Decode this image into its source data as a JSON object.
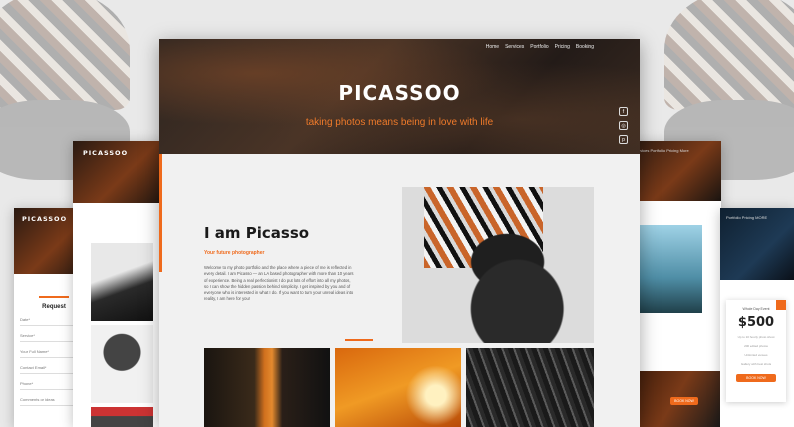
{
  "main": {
    "nav": [
      "Home",
      "Services",
      "Portfolio",
      "Pricing",
      "Booking"
    ],
    "hero_title": "PICASSOO",
    "hero_tagline": "taking photos means being in love with life",
    "social": [
      "f",
      "◎",
      "p"
    ],
    "about_title": "I am Picasso",
    "about_subtitle": "Your future photographer",
    "about_body": "Welcome to my photo portfolio and the place where a piece of me is reflected in every detail. I am Picasso — an LA based photographer with more than 10 years of experience. Being a real perfectionist I do put lots of effort into all my photos, so I can show the hidden passion behind simplicity. I get inspired by you and of everyone who is interested in what I do. If you want to turn your unreal ideas into reality, I am here for you!"
  },
  "left_card": {
    "logo": "PICASSOO"
  },
  "far_left_card": {
    "logo": "PICASSOO",
    "form_title": "Request",
    "fields": [
      "Date*",
      "Service*",
      "Your Full Name*",
      "Contact Email*",
      "Phone*",
      "Comments or ideas"
    ]
  },
  "right_card": {
    "nav": "Services   Portfolio   Pricing   More",
    "button": "BOOK NOW"
  },
  "far_right_card": {
    "nav": "Portfolio   Pricing   MORE",
    "price_label": "Whole Day Event",
    "price": "$500",
    "price_lines": [
      "Up to 10 hourly photo shoot",
      "200 edited photos",
      "Unlimited venues",
      "Gallery with best shots"
    ],
    "button": "BOOK NOW"
  },
  "colors": {
    "accent": "#ef6a1c",
    "hero_dark": "#2b2420"
  }
}
